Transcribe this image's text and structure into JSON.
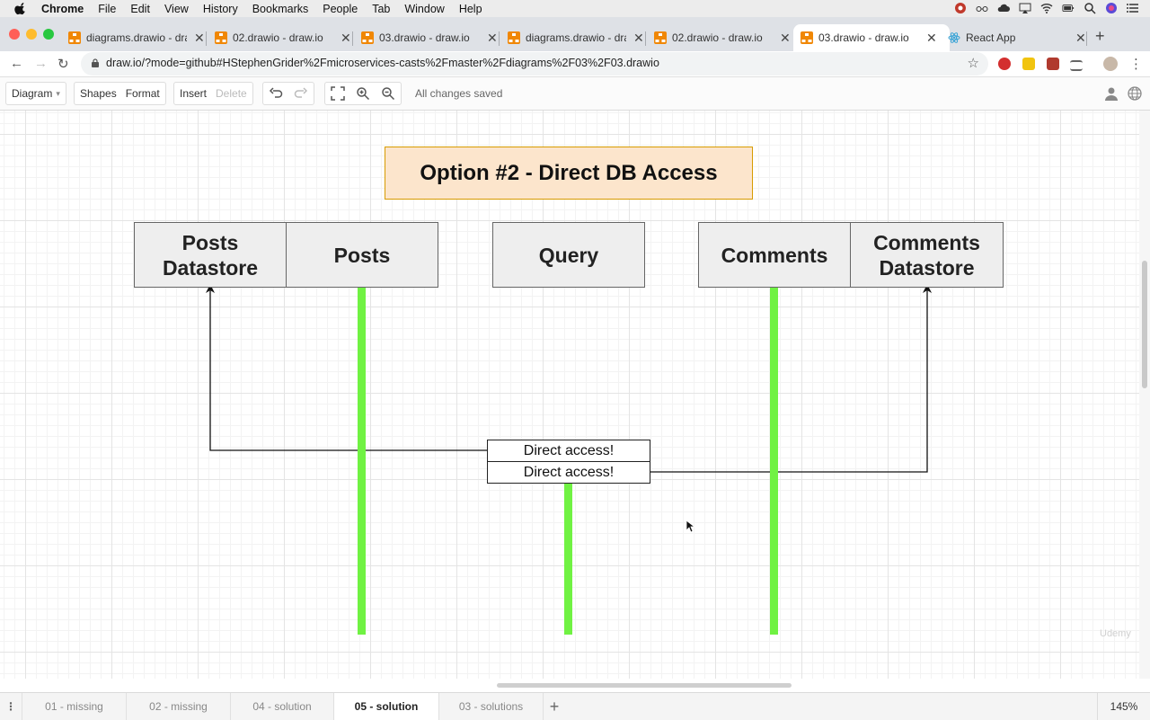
{
  "menubar": {
    "items": [
      "Chrome",
      "File",
      "Edit",
      "View",
      "History",
      "Bookmarks",
      "People",
      "Tab",
      "Window",
      "Help"
    ]
  },
  "tabs": [
    {
      "title": "diagrams.drawio - draw.io",
      "favicon": "drawio-icon"
    },
    {
      "title": "02.drawio - draw.io",
      "favicon": "drawio-icon"
    },
    {
      "title": "03.drawio - draw.io",
      "favicon": "drawio-icon"
    },
    {
      "title": "diagrams.drawio - draw.io",
      "favicon": "drawio-icon"
    },
    {
      "title": "02.drawio - draw.io",
      "favicon": "drawio-icon"
    },
    {
      "title": "03.drawio - draw.io",
      "favicon": "drawio-icon",
      "active": true
    },
    {
      "title": "React App",
      "favicon": "react-icon"
    }
  ],
  "address": {
    "url": "draw.io/?mode=github#HStephenGrider%2Fmicroservices-casts%2Fmaster%2Fdiagrams%2F03%2F03.drawio"
  },
  "toolbar": {
    "diagram": "Diagram",
    "shapes": "Shapes",
    "format": "Format",
    "insert": "Insert",
    "delete": "Delete",
    "status": "All changes saved"
  },
  "diagram": {
    "title": "Option #2 - Direct DB Access",
    "services": [
      {
        "label": "Posts\nDatastore"
      },
      {
        "label": "Posts"
      },
      {
        "label": "Query"
      },
      {
        "label": "Comments"
      },
      {
        "label": "Comments\nDatastore"
      }
    ],
    "messages": [
      "Direct access!",
      "Direct access!"
    ]
  },
  "pages": [
    "01 - missing",
    "02 - missing",
    "04 - solution",
    "05 - solution",
    "03 - solutions"
  ],
  "active_page": "05 - solution",
  "zoom": "145%",
  "watermark": "Udemy",
  "colors": {
    "lane": "#70f243",
    "title_fill": "#fce5cc",
    "title_border": "#d79b00",
    "service_fill": "#eeeeee"
  }
}
